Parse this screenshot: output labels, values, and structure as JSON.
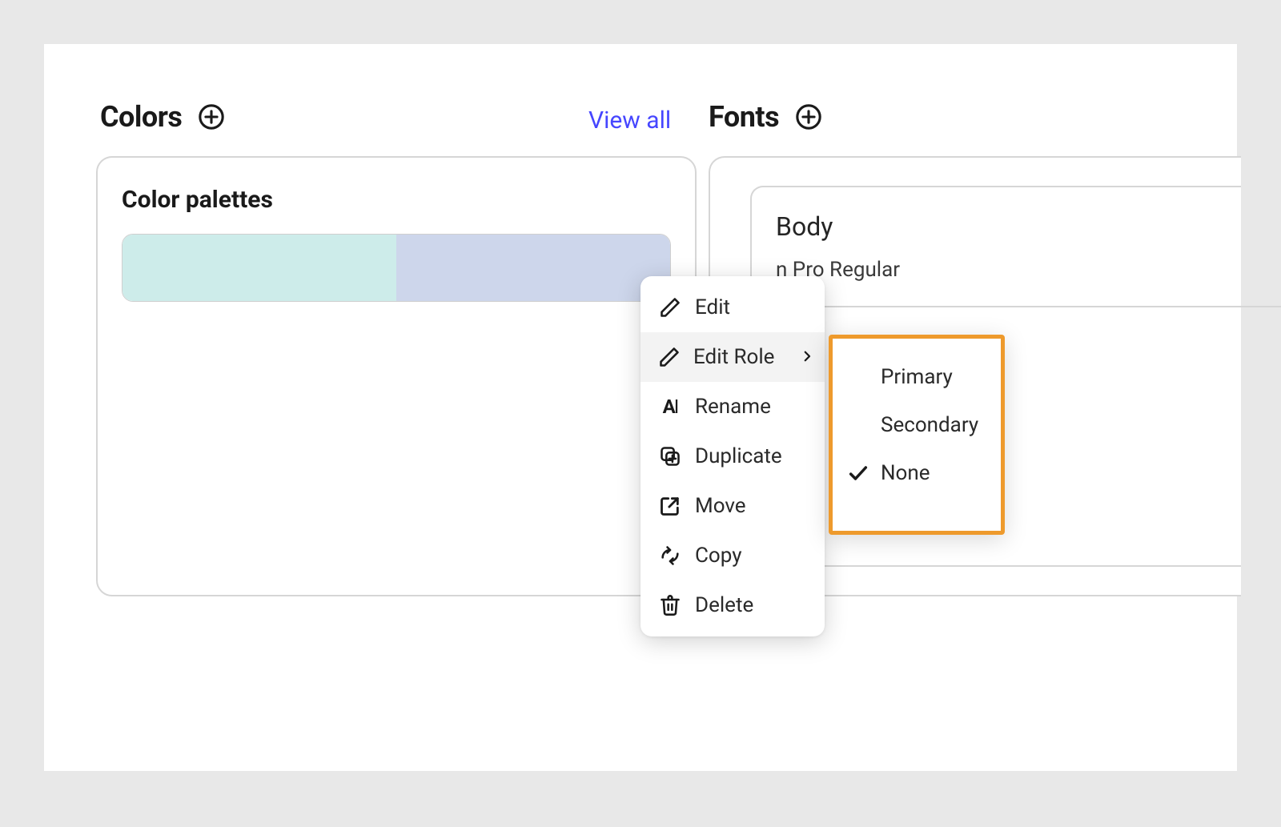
{
  "colors": {
    "title": "Colors",
    "view_all": "View all",
    "sub_title": "Color palettes",
    "palette": [
      "#cdecea",
      "#cdd6eb"
    ]
  },
  "fonts": {
    "title": "Fonts",
    "role_label": "Body",
    "font_name": "n Pro Regular"
  },
  "context_menu": {
    "edit": "Edit",
    "edit_role": "Edit Role",
    "rename": "Rename",
    "duplicate": "Duplicate",
    "move": "Move",
    "copy": "Copy",
    "delete": "Delete"
  },
  "role_submenu": {
    "primary": "Primary",
    "secondary": "Secondary",
    "none": "None",
    "selected": "None"
  }
}
